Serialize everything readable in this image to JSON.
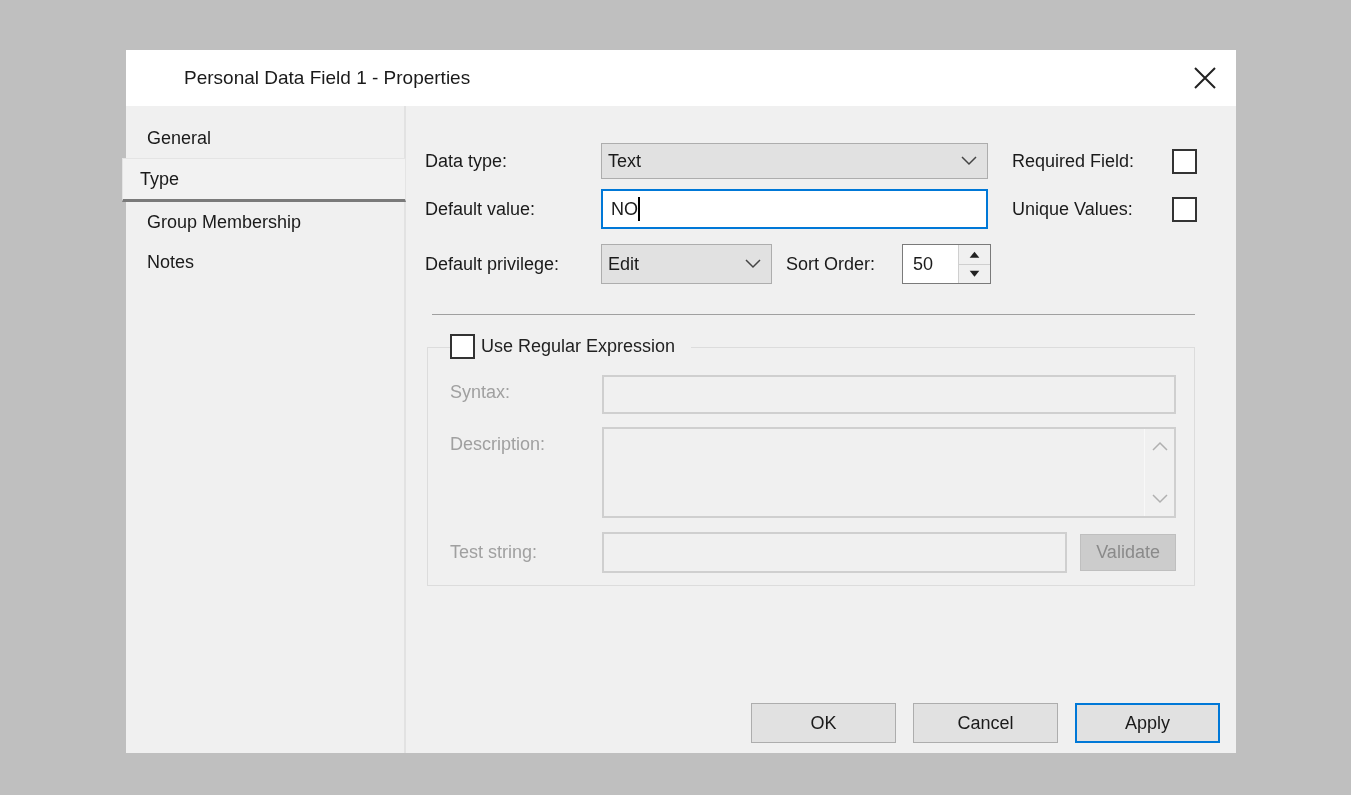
{
  "window": {
    "title": "Personal Data Field 1 - Properties"
  },
  "tabs": [
    {
      "label": "General",
      "selected": false
    },
    {
      "label": "Type",
      "selected": true
    },
    {
      "label": "Group Membership",
      "selected": false
    },
    {
      "label": "Notes",
      "selected": false
    }
  ],
  "form": {
    "data_type": {
      "label": "Data type:",
      "value": "Text"
    },
    "default_value": {
      "label": "Default value:",
      "value": "NO",
      "focused": true
    },
    "default_privilege": {
      "label": "Default privilege:",
      "value": "Edit"
    },
    "sort_order": {
      "label": "Sort Order:",
      "value": "50"
    },
    "required_field": {
      "label": "Required Field:",
      "checked": false
    },
    "unique_values": {
      "label": "Unique Values:",
      "checked": false
    }
  },
  "regex": {
    "label": "Use Regular Expression",
    "checked": false,
    "disabled": true,
    "syntax_label": "Syntax:",
    "description_label": "Description:",
    "test_string_label": "Test string:",
    "validate_button": "Validate"
  },
  "buttons": [
    {
      "label": "OK",
      "default": false
    },
    {
      "label": "Cancel",
      "default": false
    },
    {
      "label": "Apply",
      "default": true
    }
  ]
}
